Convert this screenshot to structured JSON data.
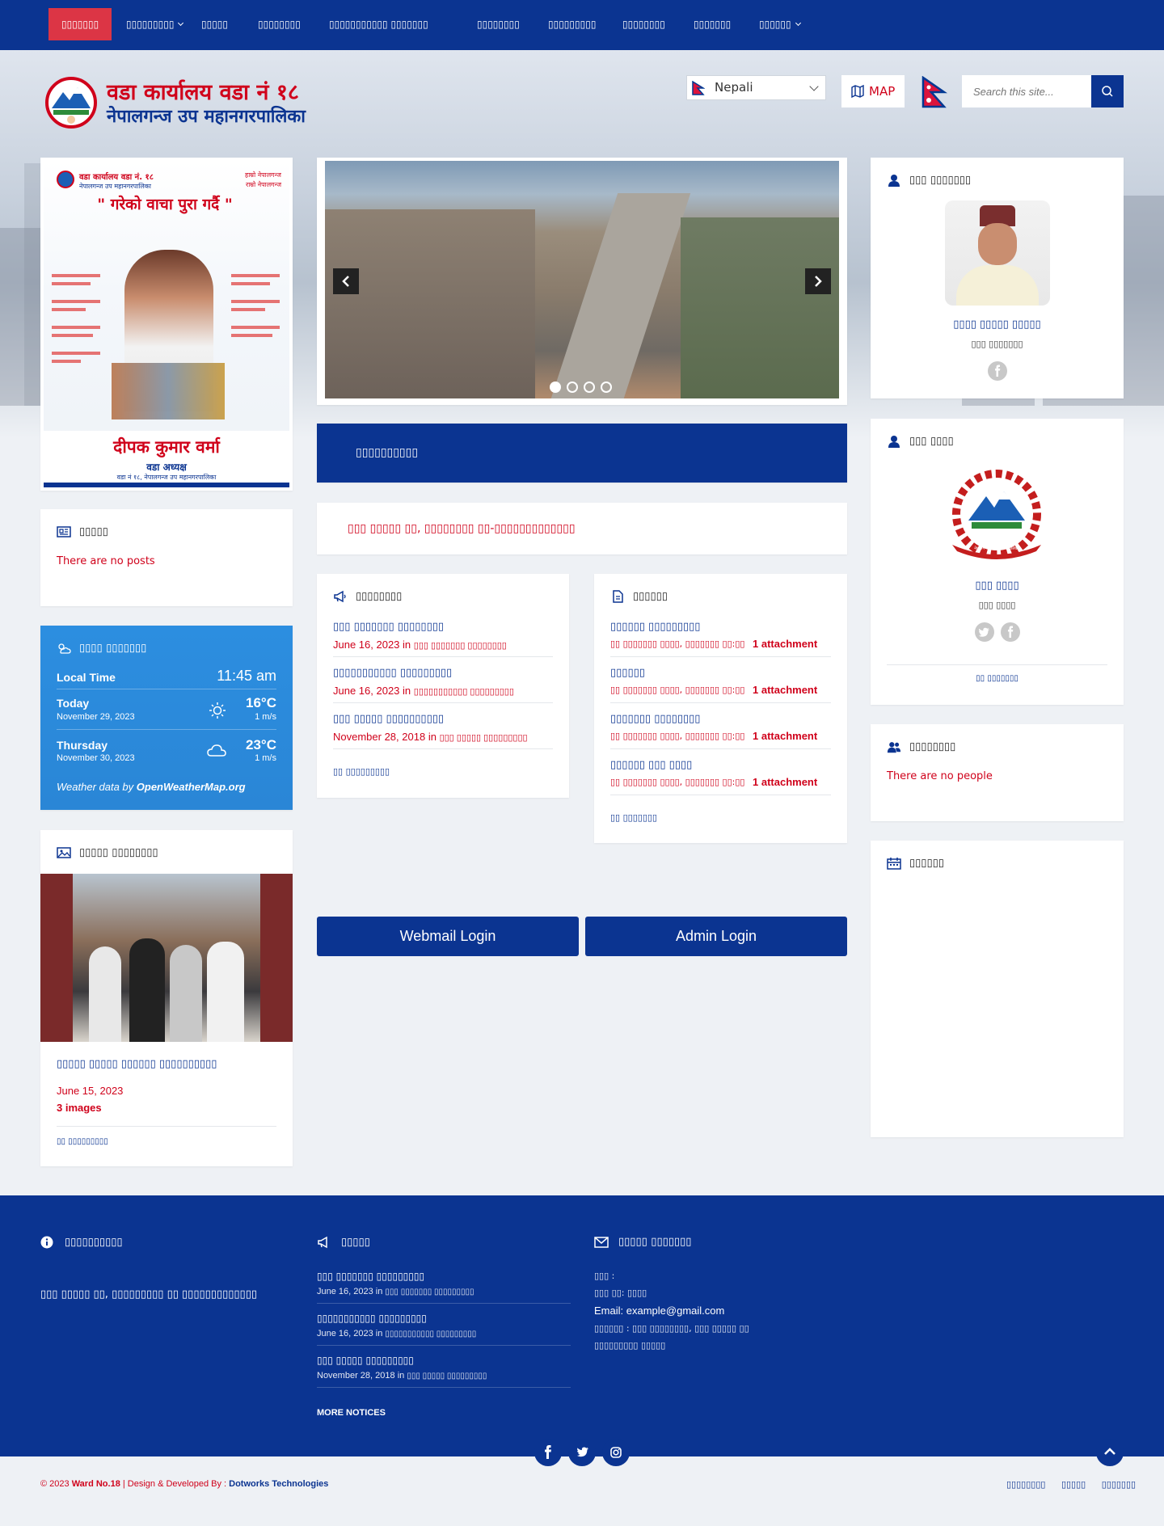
{
  "nav": {
    "items": [
      {
        "label": "▯▯▯▯▯▯▯",
        "caret": false,
        "active": true
      },
      {
        "label": "▯▯▯▯▯▯▯▯▯",
        "caret": true,
        "active": false
      },
      {
        "label": "▯▯▯▯▯",
        "caret": false,
        "active": false
      },
      {
        "label": "▯▯▯▯▯▯▯▯",
        "caret": false,
        "active": false
      },
      {
        "label": "▯▯▯▯▯▯▯▯▯▯▯ ▯▯▯▯▯▯▯",
        "caret": false,
        "active": false
      },
      {
        "label": "▯▯▯▯▯▯▯▯",
        "caret": false,
        "active": false
      },
      {
        "label": "▯▯▯▯▯▯▯▯▯",
        "caret": false,
        "active": false
      },
      {
        "label": "▯▯▯▯▯▯▯▯",
        "caret": false,
        "active": false
      },
      {
        "label": "▯▯▯▯▯▯▯",
        "caret": false,
        "active": false
      },
      {
        "label": "▯▯▯▯▯▯",
        "caret": true,
        "active": false
      }
    ]
  },
  "header": {
    "logo_line1": "वडा कार्यालय वडा नं १८",
    "logo_line2": "नेपालगन्ज उप महानगरपालिका",
    "language": "Nepali",
    "map_label": "MAP",
    "search_placeholder": "Search this site..."
  },
  "poster": {
    "org": "वडा कार्यालय वडा नं. १८",
    "sub": "नेपालगन्ज उप महानगरपालिका",
    "tagline_left": "हाम्रो नेपालगन्ज",
    "tagline_right": "राम्रो नेपालगन्ज",
    "quote": "\" गरेको वाचा पुरा गर्दै \"",
    "name": "दीपक कुमार वर्मा",
    "role": "वडा अध्यक्ष",
    "footer": "वडा नं १८, नेपालगन्ज उप महानगरपालिका"
  },
  "news_card": {
    "title": "▯▯▯▯▯",
    "empty": "There are no posts"
  },
  "weather": {
    "title": "▯▯▯▯ ▯▯▯▯▯▯▯",
    "local_time_label": "Local Time",
    "local_time": "11:45 am",
    "today_label": "Today",
    "today_date": "November 29, 2023",
    "today_temp": "16°C",
    "today_wind": "1 m/s",
    "next_label": "Thursday",
    "next_date": "November 30, 2023",
    "next_temp": "23°C",
    "next_wind": "1 m/s",
    "credit_prefix": "Weather data by ",
    "credit_source": "OpenWeatherMap.org"
  },
  "gallery": {
    "title": "▯▯▯▯▯ ▯▯▯▯▯▯▯▯",
    "caption": "▯▯▯▯▯ ▯▯▯▯▯ ▯▯▯▯▯▯ ▯▯▯▯▯▯▯▯▯▯",
    "date": "June 15, 2023",
    "count": "3 images",
    "all": "▯▯ ▯▯▯▯▯▯▯▯▯"
  },
  "notice_banner": {
    "title": "▯▯▯▯▯▯▯▯▯▯"
  },
  "ticker": {
    "text": "▯▯▯ ▯▯▯▯▯ ▯▯, ▯▯▯▯▯▯▯▯ ▯▯-▯▯▯▯▯▯▯▯▯▯▯▯▯"
  },
  "notices": {
    "title": "▯▯▯▯▯▯▯▯",
    "items": [
      {
        "title": "▯▯▯ ▯▯▯▯▯▯▯ ▯▯▯▯▯▯▯▯",
        "date": "June 16, 2023",
        "in": "in",
        "cat": "▯▯▯ ▯▯▯▯▯▯▯ ▯▯▯▯▯▯▯▯"
      },
      {
        "title": "▯▯▯▯▯▯▯▯▯▯▯ ▯▯▯▯▯▯▯▯▯",
        "date": "June 16, 2023",
        "in": "in",
        "cat": "▯▯▯▯▯▯▯▯▯▯▯ ▯▯▯▯▯▯▯▯▯"
      },
      {
        "title": "▯▯▯ ▯▯▯▯▯ ▯▯▯▯▯▯▯▯▯▯",
        "date": "November 28, 2018",
        "in": "in",
        "cat": "▯▯▯ ▯▯▯▯▯ ▯▯▯▯▯▯▯▯▯"
      }
    ],
    "all": "▯▯ ▯▯▯▯▯▯▯▯▯"
  },
  "documents": {
    "title": "▯▯▯▯▯▯",
    "items": [
      {
        "title": "▯▯▯▯▯▯ ▯▯▯▯▯▯▯▯▯",
        "meta": "▯▯ ▯▯▯▯▯▯▯ ▯▯▯▯, ▯▯▯▯▯▯▯ ▯▯:▯▯",
        "attach": "1 attachment"
      },
      {
        "title": "▯▯▯▯▯▯",
        "meta": "▯▯ ▯▯▯▯▯▯▯ ▯▯▯▯, ▯▯▯▯▯▯▯ ▯▯:▯▯",
        "attach": "1 attachment"
      },
      {
        "title": "▯▯▯▯▯▯▯ ▯▯▯▯▯▯▯▯",
        "meta": "▯▯ ▯▯▯▯▯▯▯ ▯▯▯▯, ▯▯▯▯▯▯▯ ▯▯:▯▯",
        "attach": "1 attachment"
      },
      {
        "title": "▯▯▯▯▯▯ ▯▯▯ ▯▯▯▯",
        "meta": "▯▯ ▯▯▯▯▯▯▯ ▯▯▯▯, ▯▯▯▯▯▯▯ ▯▯:▯▯",
        "attach": "1 attachment"
      }
    ],
    "all": "▯▯ ▯▯▯▯▯▯▯"
  },
  "buttons": {
    "webmail": "Webmail Login",
    "admin": "Admin Login"
  },
  "chair": {
    "title": "▯▯▯ ▯▯▯▯▯▯▯",
    "name": "▯▯▯▯ ▯▯▯▯▯ ▯▯▯▯▯",
    "role": "▯▯▯ ▯▯▯▯▯▯▯"
  },
  "ward": {
    "title": "▯▯▯ ▯▯▯▯",
    "emblem_text": "नेपालगन्ज उप महानगरपालिका",
    "name": "▯▯▯ ▯▯▯▯",
    "role": "▯▯▯ ▯▯▯▯",
    "all": "▯▯ ▯▯▯▯▯▯▯"
  },
  "people": {
    "title": "▯▯▯▯▯▯▯▯",
    "empty": "There are no people"
  },
  "calendar": {
    "title": "▯▯▯▯▯▯"
  },
  "footer": {
    "about_title": "▯▯▯▯▯▯▯▯▯▯",
    "about_text": "▯▯▯ ▯▯▯▯▯ ▯▯, ▯▯▯▯▯▯▯▯▯ ▯▯ ▯▯▯▯▯▯▯▯▯▯▯▯▯",
    "notice_title": "▯▯▯▯▯",
    "notices": [
      {
        "title": "▯▯▯ ▯▯▯▯▯▯▯ ▯▯▯▯▯▯▯▯▯",
        "date": "June 16, 2023",
        "in": "in",
        "cat": "▯▯▯ ▯▯▯▯▯▯▯ ▯▯▯▯▯▯▯▯▯"
      },
      {
        "title": "▯▯▯▯▯▯▯▯▯▯▯ ▯▯▯▯▯▯▯▯▯",
        "date": "June 16, 2023",
        "in": "in",
        "cat": "▯▯▯▯▯▯▯▯▯▯▯ ▯▯▯▯▯▯▯▯▯"
      },
      {
        "title": "▯▯▯ ▯▯▯▯▯ ▯▯▯▯▯▯▯▯▯",
        "date": "November 28, 2018",
        "in": "in",
        "cat": "▯▯▯ ▯▯▯▯▯ ▯▯▯▯▯▯▯▯▯"
      }
    ],
    "more": "MORE NOTICES",
    "contact_title": "▯▯▯▯▯ ▯▯▯▯▯▯▯",
    "contact_phone": "▯▯▯ :",
    "contact_mobile": "▯▯▯ ▯▯: ▯▯▯▯",
    "contact_email_label": "Email:",
    "contact_email": "example@gmail.com",
    "contact_addr1": "▯▯▯▯▯▯ : ▯▯▯ ▯▯▯▯▯▯▯▯, ▯▯▯ ▯▯▯▯▯ ▯▯",
    "contact_addr2": "▯▯▯▯▯▯▯▯▯ ▯▯▯▯▯"
  },
  "bottom": {
    "copy": "© 2023 ",
    "site": "Ward No.18",
    "dev_prefix": " | Design & Developed By : ",
    "dev": "Dotworks Technologies",
    "links": [
      "▯▯▯▯▯▯▯▯",
      "▯▯▯▯▯",
      "▯▯▯▯▯▯▯"
    ]
  },
  "colors": {
    "primary": "#0b3491",
    "accent": "#dc3545",
    "red": "#d0021b",
    "weather": "#2789d8"
  }
}
